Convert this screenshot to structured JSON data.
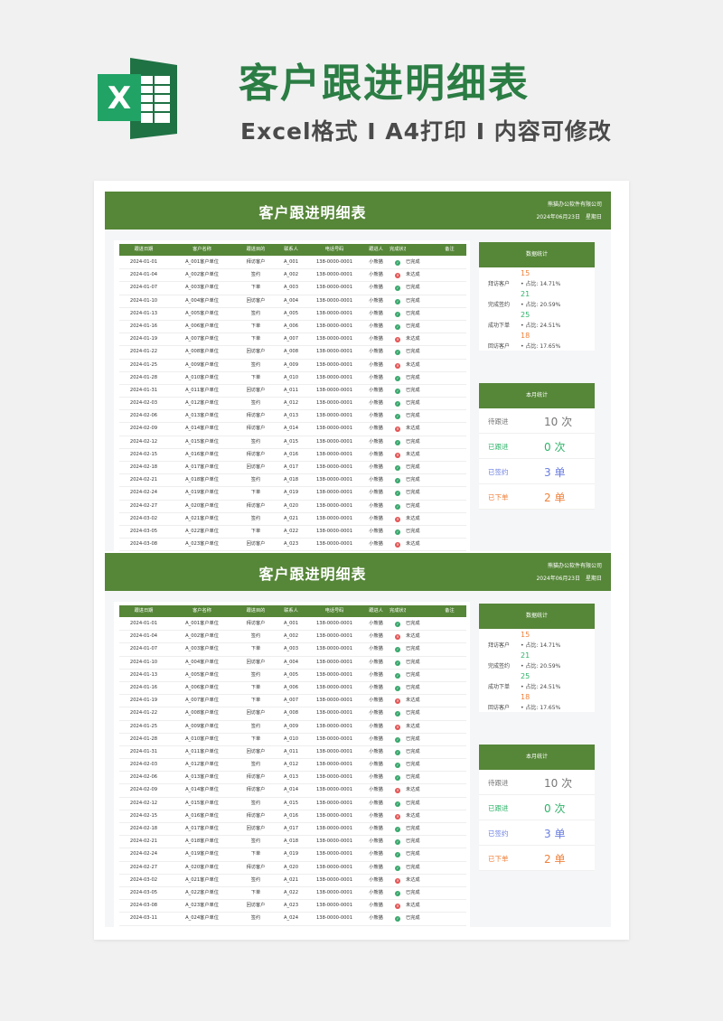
{
  "header": {
    "title": "客户跟进明细表",
    "subtitle": "Excel格式 I A4打印 I 内容可修改",
    "logo_letter": "X"
  },
  "sheet": {
    "title": "客户跟进明细表",
    "company": "熊猫办公软件有限公司",
    "date": "2024年06月23日　星期日",
    "columns": [
      "跟进日期",
      "客户名称",
      "跟进目的",
      "联系人",
      "电话号码",
      "跟进人",
      "完成状态",
      "",
      "备注"
    ],
    "rows": [
      [
        "2024-01-01",
        "A_001客户单位",
        "拜访客户",
        "A_001",
        "138-0000-0001",
        "小熊猫",
        "ok",
        "已完成"
      ],
      [
        "2024-01-04",
        "A_002客户单位",
        "签约",
        "A_002",
        "138-0000-0001",
        "小熊猫",
        "no",
        "未达成"
      ],
      [
        "2024-01-07",
        "A_003客户单位",
        "下单",
        "A_003",
        "138-0000-0001",
        "小熊猫",
        "ok",
        "已完成"
      ],
      [
        "2024-01-10",
        "A_004客户单位",
        "回访客户",
        "A_004",
        "138-0000-0001",
        "小熊猫",
        "ok",
        "已完成"
      ],
      [
        "2024-01-13",
        "A_005客户单位",
        "签约",
        "A_005",
        "138-0000-0001",
        "小熊猫",
        "ok",
        "已完成"
      ],
      [
        "2024-01-16",
        "A_006客户单位",
        "下单",
        "A_006",
        "138-0000-0001",
        "小熊猫",
        "ok",
        "已完成"
      ],
      [
        "2024-01-19",
        "A_007客户单位",
        "下单",
        "A_007",
        "138-0000-0001",
        "小熊猫",
        "no",
        "未达成"
      ],
      [
        "2024-01-22",
        "A_008客户单位",
        "回访客户",
        "A_008",
        "138-0000-0001",
        "小熊猫",
        "ok",
        "已完成"
      ],
      [
        "2024-01-25",
        "A_009客户单位",
        "签约",
        "A_009",
        "138-0000-0001",
        "小熊猫",
        "no",
        "未达成"
      ],
      [
        "2024-01-28",
        "A_010客户单位",
        "下单",
        "A_010",
        "138-0000-0001",
        "小熊猫",
        "ok",
        "已完成"
      ],
      [
        "2024-01-31",
        "A_011客户单位",
        "回访客户",
        "A_011",
        "138-0000-0001",
        "小熊猫",
        "ok",
        "已完成"
      ],
      [
        "2024-02-03",
        "A_012客户单位",
        "签约",
        "A_012",
        "138-0000-0001",
        "小熊猫",
        "ok",
        "已完成"
      ],
      [
        "2024-02-06",
        "A_013客户单位",
        "拜访客户",
        "A_013",
        "138-0000-0001",
        "小熊猫",
        "ok",
        "已完成"
      ],
      [
        "2024-02-09",
        "A_014客户单位",
        "拜访客户",
        "A_014",
        "138-0000-0001",
        "小熊猫",
        "no",
        "未达成"
      ],
      [
        "2024-02-12",
        "A_015客户单位",
        "签约",
        "A_015",
        "138-0000-0001",
        "小熊猫",
        "ok",
        "已完成"
      ],
      [
        "2024-02-15",
        "A_016客户单位",
        "拜访客户",
        "A_016",
        "138-0000-0001",
        "小熊猫",
        "no",
        "未达成"
      ],
      [
        "2024-02-18",
        "A_017客户单位",
        "回访客户",
        "A_017",
        "138-0000-0001",
        "小熊猫",
        "ok",
        "已完成"
      ],
      [
        "2024-02-21",
        "A_018客户单位",
        "签约",
        "A_018",
        "138-0000-0001",
        "小熊猫",
        "ok",
        "已完成"
      ],
      [
        "2024-02-24",
        "A_019客户单位",
        "下单",
        "A_019",
        "138-0000-0001",
        "小熊猫",
        "ok",
        "已完成"
      ],
      [
        "2024-02-27",
        "A_020客户单位",
        "拜访客户",
        "A_020",
        "138-0000-0001",
        "小熊猫",
        "ok",
        "已完成"
      ],
      [
        "2024-03-02",
        "A_021客户单位",
        "签约",
        "A_021",
        "138-0000-0001",
        "小熊猫",
        "no",
        "未达成"
      ],
      [
        "2024-03-05",
        "A_022客户单位",
        "下单",
        "A_022",
        "138-0000-0001",
        "小熊猫",
        "ok",
        "已完成"
      ],
      [
        "2024-03-08",
        "A_023客户单位",
        "回访客户",
        "A_023",
        "138-0000-0001",
        "小熊猫",
        "no",
        "未达成"
      ],
      [
        "2024-03-11",
        "A_024客户单位",
        "签约",
        "A_024",
        "138-0000-0001",
        "小熊猫",
        "ok",
        "已完成"
      ]
    ],
    "data_stats": {
      "title": "数据统计",
      "items": [
        {
          "value": "15",
          "label": "拜访客户",
          "pct": "• 占比: 14.71%",
          "color": "#f0823c"
        },
        {
          "value": "21",
          "label": "完成签约",
          "pct": "• 占比: 20.59%",
          "color": "#2fb36a"
        },
        {
          "value": "25",
          "label": "成功下单",
          "pct": "• 占比: 24.51%",
          "color": "#2fb36a"
        },
        {
          "value": "18",
          "label": "回访客户",
          "pct": "• 占比: 17.65%",
          "color": "#f0823c"
        }
      ]
    },
    "month_stats": {
      "title": "本月统计",
      "items": [
        {
          "label": "待跟进",
          "value": "10 次",
          "color": "#777777"
        },
        {
          "label": "已跟进",
          "value": "0 次",
          "color": "#2fb36a"
        },
        {
          "label": "已签约",
          "value": "3 单",
          "color": "#6a7ee0"
        },
        {
          "label": "已下单",
          "value": "2 单",
          "color": "#f0823c"
        }
      ]
    }
  },
  "colors": {
    "brand_green": "#568638",
    "title_green": "#2b7d44",
    "ok": "#3aa76d",
    "no": "#e35454"
  }
}
